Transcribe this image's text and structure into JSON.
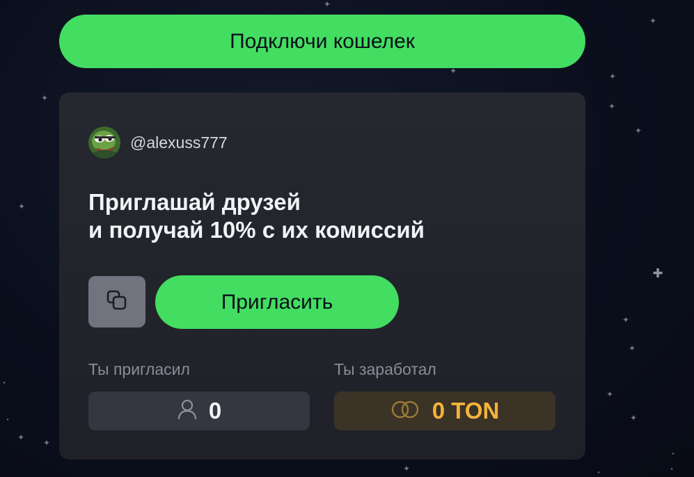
{
  "header": {
    "connect_wallet_label": "Подключи кошелек"
  },
  "card": {
    "username": "@alexuss777",
    "headline_line1": "Приглашай друзей",
    "headline_line2": "и получай 10% с их комиссий",
    "invite_label": "Пригласить",
    "invited_label": "Ты пригласил",
    "invited_count": "0",
    "earned_label": "Ты заработал",
    "earned_value": "0 TON"
  },
  "icons": {
    "avatar": "pepe-avatar",
    "copy": "copy-icon",
    "person": "person-icon",
    "coins": "coins-icon",
    "stars": "sparkle-star"
  },
  "colors": {
    "accent_green": "#43dd61",
    "ton_gold": "#f5b33c",
    "card_bg": "#262830",
    "page_bg": "#0b0f1d"
  }
}
